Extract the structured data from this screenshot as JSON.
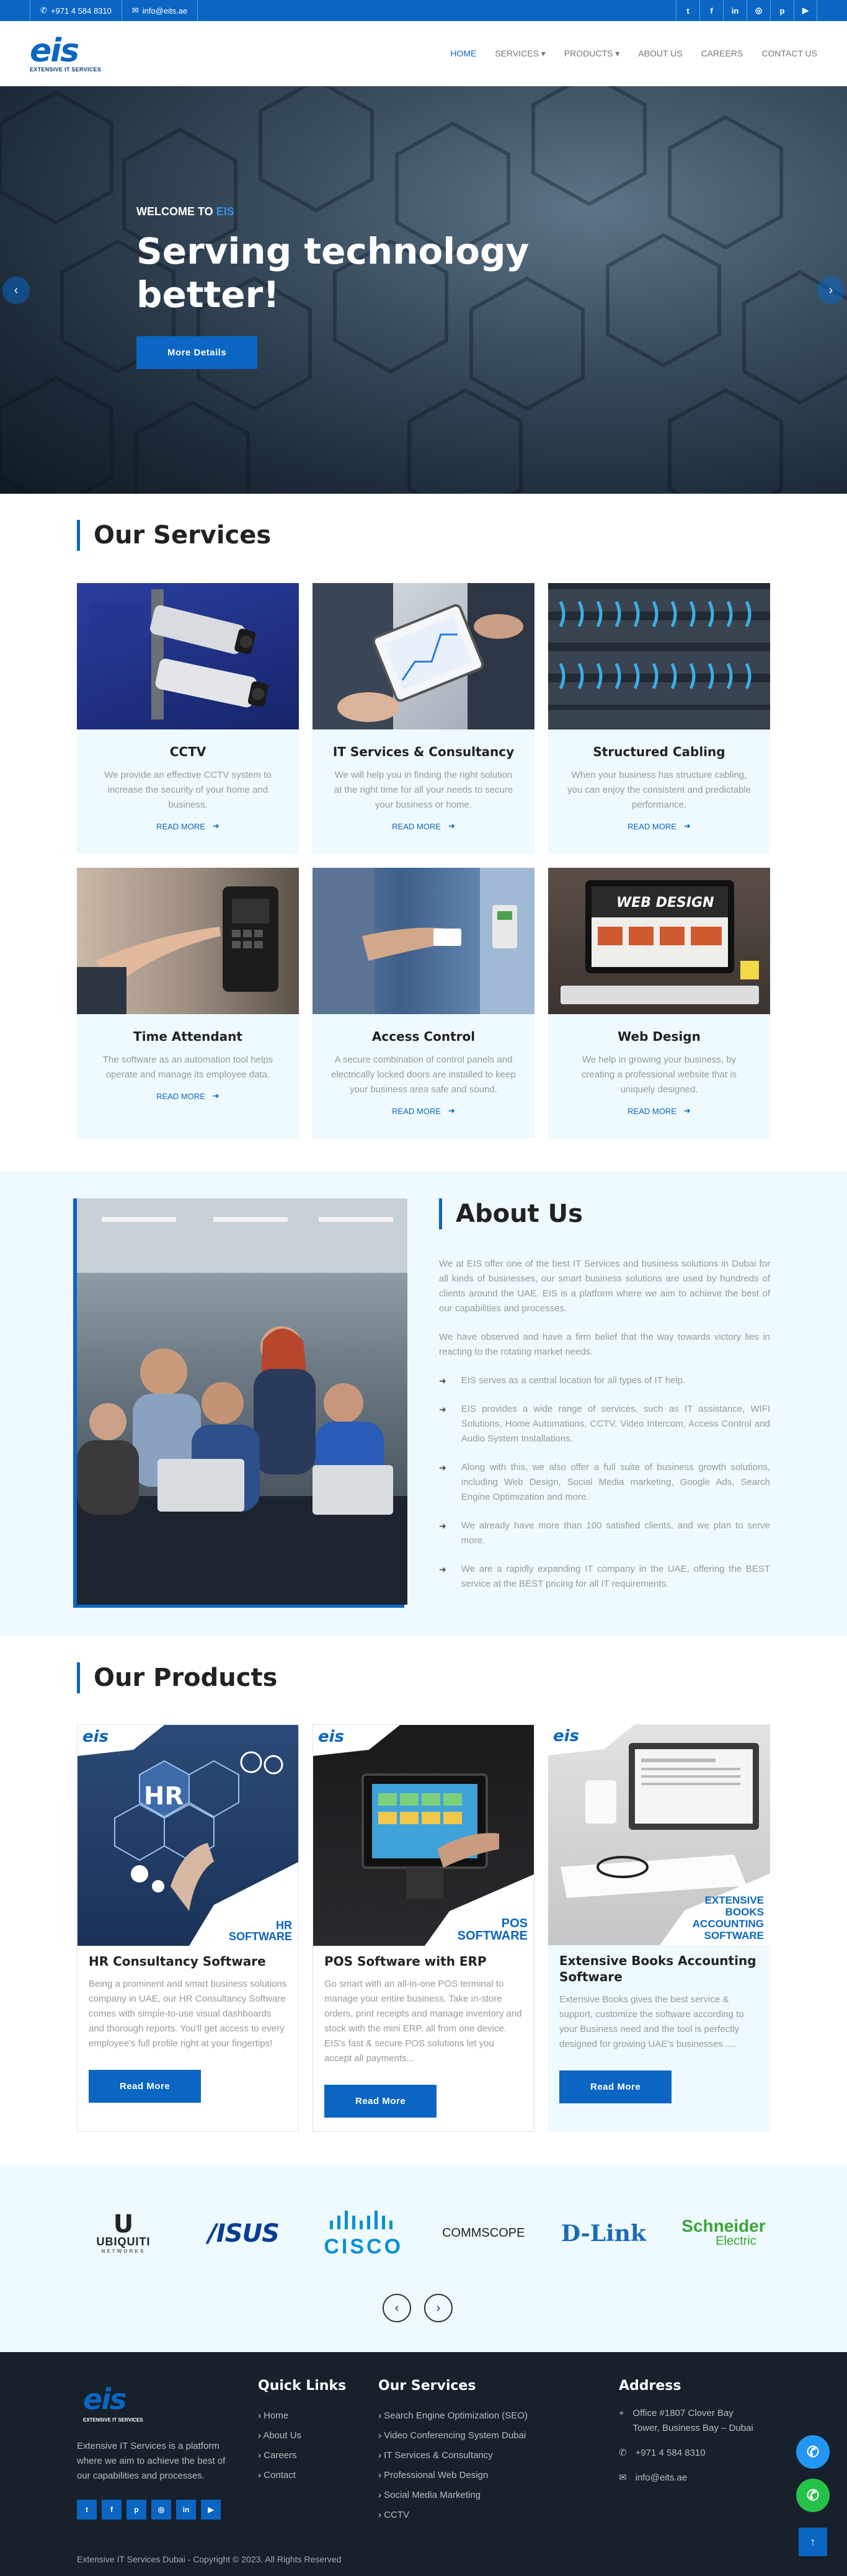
{
  "topbar": {
    "phone": "+971 4 584 8310",
    "email": "info@eits.ae",
    "socials": [
      {
        "icon": "twitter-icon",
        "glyph": "t"
      },
      {
        "icon": "facebook-icon",
        "glyph": "f"
      },
      {
        "icon": "linkedin-icon",
        "glyph": "in"
      },
      {
        "icon": "instagram-icon",
        "glyph": "◎"
      },
      {
        "icon": "pinterest-icon",
        "glyph": "p"
      },
      {
        "icon": "youtube-icon",
        "glyph": "▶"
      }
    ]
  },
  "header": {
    "logo_mark": "eis",
    "logo_tag": "EXTENSIVE IT SERVICES",
    "nav": [
      {
        "label": "HOME",
        "active": true
      },
      {
        "label": "SERVICES ▾"
      },
      {
        "label": "PRODUCTS ▾"
      },
      {
        "label": "ABOUT US"
      },
      {
        "label": "CAREERS"
      },
      {
        "label": "CONTACT US"
      }
    ]
  },
  "hero": {
    "welcome_prefix": "WELCOME TO",
    "welcome_brand": "EIS",
    "headline": "Serving technology better!",
    "button": "More Details",
    "prev": "‹",
    "next": "›"
  },
  "services": {
    "title": "Our Services",
    "read_more": "READ MORE",
    "items": [
      {
        "title": "CCTV",
        "text": "We provide an effective CCTV system to increase the security of your home and business."
      },
      {
        "title": "IT Services & Consultancy",
        "text": "We will help you in finding the right solution at the right time for all your needs to secure your business or home."
      },
      {
        "title": "Structured Cabling",
        "text": "When your business has structure cabling, you can enjoy the consistent and predictable performance."
      },
      {
        "title": "Time Attendant",
        "text": "The software as an automation tool helps operate and manage its employee data."
      },
      {
        "title": "Access Control",
        "text": "A secure combination of control panels and electrically locked doors are installed to keep your business area safe and sound."
      },
      {
        "title": "Web Design",
        "text": "We help in growing your business, by creating a professional website that is uniquely designed."
      }
    ],
    "web_design_banner": "WEB DESIGN"
  },
  "about": {
    "title": "About Us",
    "para1": "We at EIS offer one of the best IT Services and business solutions in Dubai for all kinds of businesses, our smart business solutions are used by hundreds of clients around the UAE. EIS is a platform where we aim to achieve the best of our capabilities and processes.",
    "para2": "We have observed and have a firm belief that the way towards victory lies in reacting to the rotating market needs.",
    "points": [
      "EIS serves as a central location for all types of IT help.",
      "EIS provides a wide range of services, such as IT assistance, WIFI Solutions, Home Automations, CCTV, Video Intercom, Access Control and Audio System Installations.",
      "Along with this, we also offer a full suite of business growth solutions, including Web Design, Social Media marketing, Google Ads, Search Engine Optimization and more.",
      "We already have more than 100 satisfied clients, and we plan to serve more.",
      "We are a rapidly expanding IT company in the UAE, offering the BEST service at the BEST pricing for all IT requirements."
    ]
  },
  "products": {
    "title": "Our Products",
    "button": "Read More",
    "items": [
      {
        "title": "HR Consultancy Software",
        "badge1": "HR",
        "badge2": "SOFTWARE",
        "text": "Being a prominent and smart business solutions company in UAE, our HR Consultancy Software comes with simple-to-use visual dashboards and thorough reports. You'll get access to every employee's full profile right at your fingertips!"
      },
      {
        "title": "POS Software with ERP",
        "badge1": "POS",
        "badge2": "SOFTWARE",
        "text": "Go smart with an all-in-one POS terminal to manage your entire business. Take in-store orders, print receipts and manage inventory and stock with the mini ERP, all from one device. EIS's fast & secure POS solutions let you accept all payments..."
      },
      {
        "title": "Extensive Books Accounting Software",
        "badge1": "EXTENSIVE",
        "badge2": "BOOKS ACCOUNTING SOFTWARE",
        "text": "Extensive Books gives the best service & support, customize the software according to your Business need and the tool is perfectly designed for growing UAE's businesses ...."
      }
    ],
    "hr_label": "HR"
  },
  "brands": {
    "items": [
      {
        "name": "UBIQUITI",
        "sub": "NETWORKS",
        "color": "#222222"
      },
      {
        "name": "/ISUS",
        "sub": "",
        "color": "#0a3d91"
      },
      {
        "name": "CISCO",
        "sub": "",
        "color": "#0a8fd6"
      },
      {
        "name": "COMMSCOPE",
        "sub": "",
        "color": "#222222"
      },
      {
        "name": "D-Link",
        "sub": "",
        "color": "#1c6bb5"
      },
      {
        "name": "Schneider",
        "sub": "Electric",
        "color": "#3aa535"
      }
    ],
    "prev": "‹",
    "next": "›"
  },
  "footer": {
    "logo_mark": "eis",
    "logo_tag": "EXTENSIVE IT SERVICES",
    "about_text": "Extensive IT Services is a platform where we aim to achieve the best of our capabilities and processes.",
    "socials": [
      "t",
      "f",
      "p",
      "◎",
      "in",
      "▶"
    ],
    "quick_links_title": "Quick Links",
    "quick_links": [
      "Home",
      "About Us",
      "Careers",
      "Contact"
    ],
    "services_title": "Our Services",
    "services": [
      "Search Engine Optimization (SEO)",
      "Video Conferencing System Dubai",
      "IT Services & Consultancy",
      "Professional Web Design",
      "Social Media Marketing",
      "CCTV"
    ],
    "address_title": "Address",
    "address": "Office #1807 Clover Bay Tower, Business Bay – Dubai",
    "phone": "+971 4 584 8310",
    "email": "info@eits.ae",
    "copyright": "Extensive IT Services Dubai - Copyright © 2023. All Rights Reserved",
    "to_top": "↑"
  }
}
